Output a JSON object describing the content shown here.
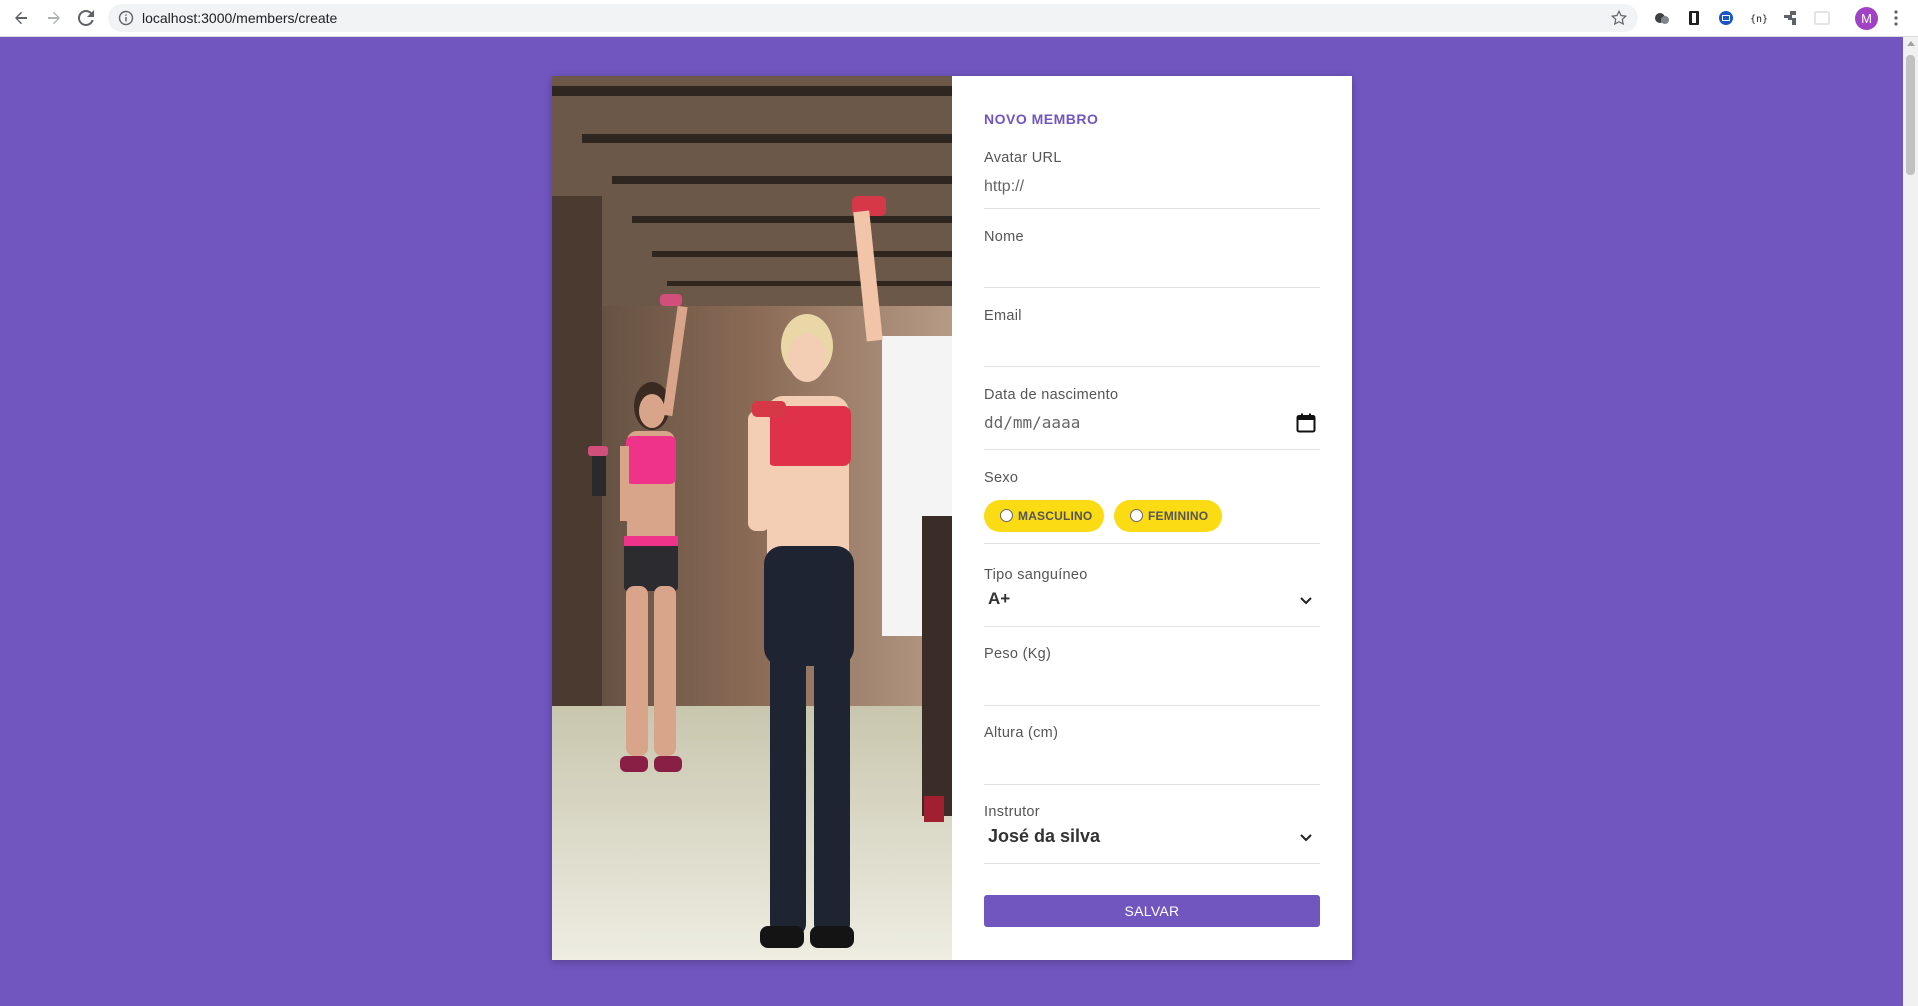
{
  "browser": {
    "url": "localhost:3000/members/create",
    "profile_initial": "M"
  },
  "form": {
    "title": "NOVO MEMBRO",
    "avatar": {
      "label": "Avatar URL",
      "placeholder": "http://"
    },
    "nome": {
      "label": "Nome",
      "value": ""
    },
    "email": {
      "label": "Email",
      "value": ""
    },
    "nascimento": {
      "label": "Data de nascimento",
      "placeholder": "dd/mm/aaaa"
    },
    "sexo": {
      "label": "Sexo",
      "options": [
        "MASCULINO",
        "FEMININO"
      ]
    },
    "tipo_sanguineo": {
      "label": "Tipo sanguíneo",
      "selected": "A+"
    },
    "peso": {
      "label": "Peso (Kg)",
      "value": ""
    },
    "altura": {
      "label": "Altura (cm)",
      "value": ""
    },
    "instrutor": {
      "label": "Instrutor",
      "selected": "José da silva"
    },
    "submit_label": "SALVAR"
  },
  "icons": {
    "back": "arrow-left-icon",
    "forward": "arrow-right-icon",
    "reload": "reload-icon",
    "info": "info-icon",
    "bookmark": "star-icon",
    "calendar": "calendar-icon",
    "chevron": "chevron-down-icon"
  },
  "colors": {
    "background": "#7156c0",
    "accent": "#7156c0",
    "pill": "#fadb14"
  }
}
